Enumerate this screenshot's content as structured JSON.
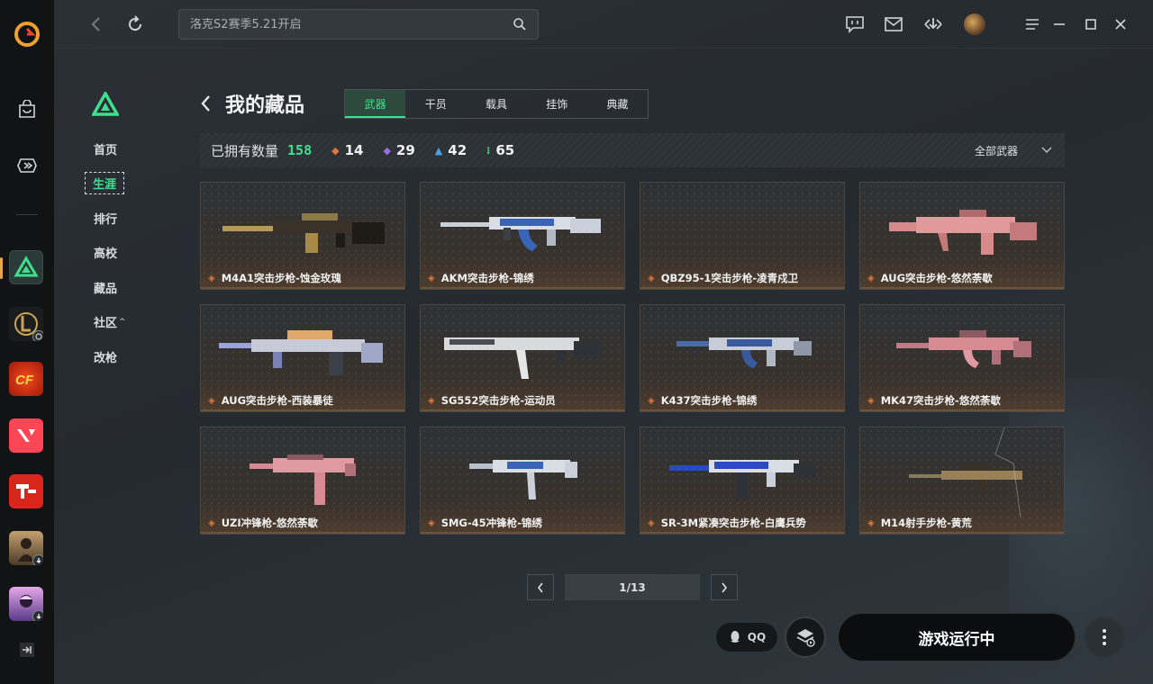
{
  "search": {
    "placeholder": "洛克S2赛季5.21开启"
  },
  "subnav": {
    "items": [
      {
        "label": "首页"
      },
      {
        "label": "生涯"
      },
      {
        "label": "排行"
      },
      {
        "label": "高校"
      },
      {
        "label": "藏品"
      },
      {
        "label": "社区",
        "caret": "^"
      },
      {
        "label": "改枪"
      }
    ]
  },
  "header": {
    "title": "我的藏品"
  },
  "tabs": [
    {
      "label": "武器"
    },
    {
      "label": "干员"
    },
    {
      "label": "载具"
    },
    {
      "label": "挂饰"
    },
    {
      "label": "典藏"
    }
  ],
  "stats": {
    "owned_label": "已拥有数量",
    "total": "158",
    "counts": [
      {
        "value": "14",
        "color": "#e07a3a",
        "icon": "diamond-orange-icon"
      },
      {
        "value": "29",
        "color": "#9a6ee0",
        "icon": "diamond-purple-icon"
      },
      {
        "value": "42",
        "color": "#4aa3e0",
        "icon": "shard-blue-icon"
      },
      {
        "value": "65",
        "color": "#3ee08e",
        "icon": "dots-green-icon"
      }
    ],
    "filter": "全部武器"
  },
  "weapons": [
    {
      "name": "M4A1突击步枪-蚀金玫瑰"
    },
    {
      "name": "AKM突击步枪-锦绣"
    },
    {
      "name": "QBZ95-1突击步枪-凌青戍卫"
    },
    {
      "name": "AUG突击步枪-悠然荼歇"
    },
    {
      "name": "AUG突击步枪-西装暴徒"
    },
    {
      "name": "SG552突击步枪-运动员"
    },
    {
      "name": "K437突击步枪-锦绣"
    },
    {
      "name": "MK47突击步枪-悠然荼歇"
    },
    {
      "name": "UZI冲锋枪-悠然荼歇"
    },
    {
      "name": "SMG-45冲锋枪-锦绣"
    },
    {
      "name": "SR-3M紧凑突击步枪-白鹰兵势"
    },
    {
      "name": "M14射手步枪-黄荒"
    }
  ],
  "pagination": {
    "page": "1/13"
  },
  "bottom": {
    "qq": "QQ",
    "launch": "游戏运行中"
  },
  "colors": {
    "accent": "#3ee08e",
    "rarity_orange": "#e07a3a"
  }
}
